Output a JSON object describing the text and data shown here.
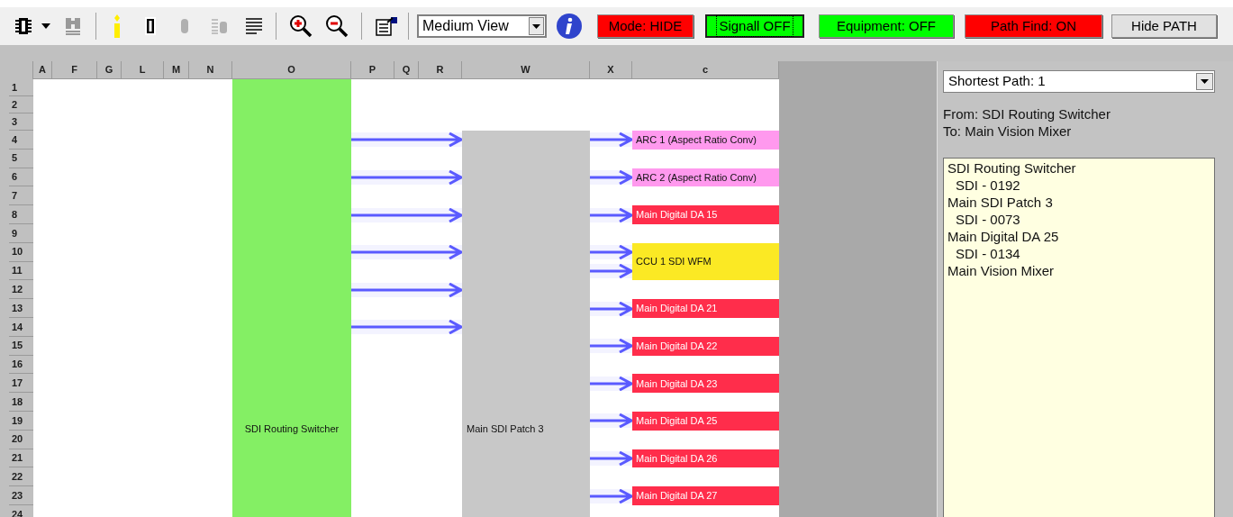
{
  "toolbar": {
    "view_select": {
      "value": "Medium View"
    },
    "toggles": [
      {
        "label": "Mode: HIDE",
        "color": "#ff0000",
        "focused": false
      },
      {
        "label": "Signall OFF",
        "color": "#00ff00",
        "focused": true
      },
      {
        "label": "Equipment: OFF",
        "color": "#00ff00",
        "focused": false
      },
      {
        "label": "Path Find: ON",
        "color": "#ff0000",
        "focused": false
      },
      {
        "label": "Hide PATH",
        "color": "#e1e1e1",
        "focused": false
      }
    ]
  },
  "sheet": {
    "column_headers": [
      "A",
      "F",
      "G",
      "L",
      "M",
      "N",
      "O",
      "P",
      "Q",
      "R",
      "W",
      "X",
      "c"
    ],
    "row_headers": [
      "1",
      "2",
      "3",
      "4",
      "5",
      "6",
      "7",
      "8",
      "9",
      "10",
      "11",
      "12",
      "13",
      "14",
      "15",
      "16",
      "17",
      "18",
      "19",
      "20",
      "21",
      "22",
      "23",
      "24"
    ],
    "source": {
      "label": "SDI Routing Switcher",
      "color": "#84ef64"
    },
    "patch": {
      "label": "Main SDI Patch 3",
      "color": "#c8c8c8"
    },
    "targets": [
      {
        "label": "ARC 1 (Aspect Ratio Conv)",
        "color": "#ff99ee",
        "tall": false
      },
      {
        "label": "ARC 2 (Aspect Ratio Conv)",
        "color": "#ff99ee",
        "tall": false
      },
      {
        "label": "Main Digital DA 15",
        "color": "#ff2d4b",
        "tall": false
      },
      {
        "label": "CCU 1 SDI WFM",
        "color": "#fbe924",
        "tall": true
      },
      {
        "label": "Main Digital DA 21",
        "color": "#ff2d4b",
        "tall": false
      },
      {
        "label": "Main Digital DA 22",
        "color": "#ff2d4b",
        "tall": false
      },
      {
        "label": "Main Digital DA 23",
        "color": "#ff2d4b",
        "tall": false
      },
      {
        "label": "Main Digital DA 25",
        "color": "#ff2d4b",
        "tall": false
      },
      {
        "label": "Main Digital DA 26",
        "color": "#ff2d4b",
        "tall": false
      },
      {
        "label": "Main Digital DA 27",
        "color": "#ff2d4b",
        "tall": false
      }
    ]
  },
  "path_panel": {
    "path_select": {
      "value": "Shortest Path: 1"
    },
    "from": "From: SDI Routing Switcher",
    "to": "To: Main Vision Mixer",
    "steps": [
      {
        "text": "SDI Routing Switcher",
        "kind": "device"
      },
      {
        "text": "SDI - 0192",
        "kind": "link"
      },
      {
        "text": "Main SDI Patch 3",
        "kind": "device"
      },
      {
        "text": "SDI - 0073",
        "kind": "link"
      },
      {
        "text": "Main Digital DA 25",
        "kind": "device"
      },
      {
        "text": "SDI - 0134",
        "kind": "link"
      },
      {
        "text": "Main Vision Mixer",
        "kind": "device"
      }
    ]
  }
}
